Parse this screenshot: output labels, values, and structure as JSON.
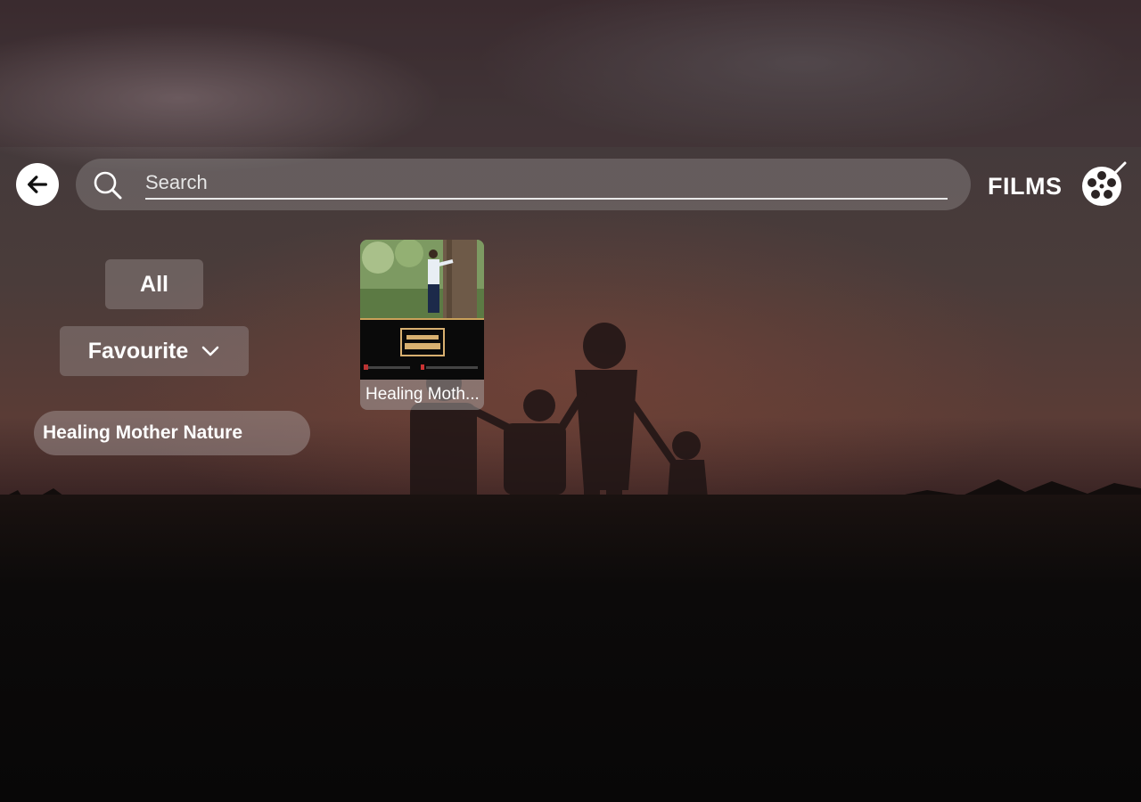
{
  "search": {
    "placeholder": "Search"
  },
  "header": {
    "section_label": "FILMS"
  },
  "filters": {
    "all_label": "All",
    "favourite_label": "Favourite",
    "active_tag": "Healing Mother Nature"
  },
  "films": [
    {
      "title": "Healing Moth..."
    }
  ],
  "icons": {
    "back": "arrow-left-icon",
    "search": "search-icon",
    "films": "film-reel-icon",
    "dropdown": "chevron-down-icon"
  }
}
